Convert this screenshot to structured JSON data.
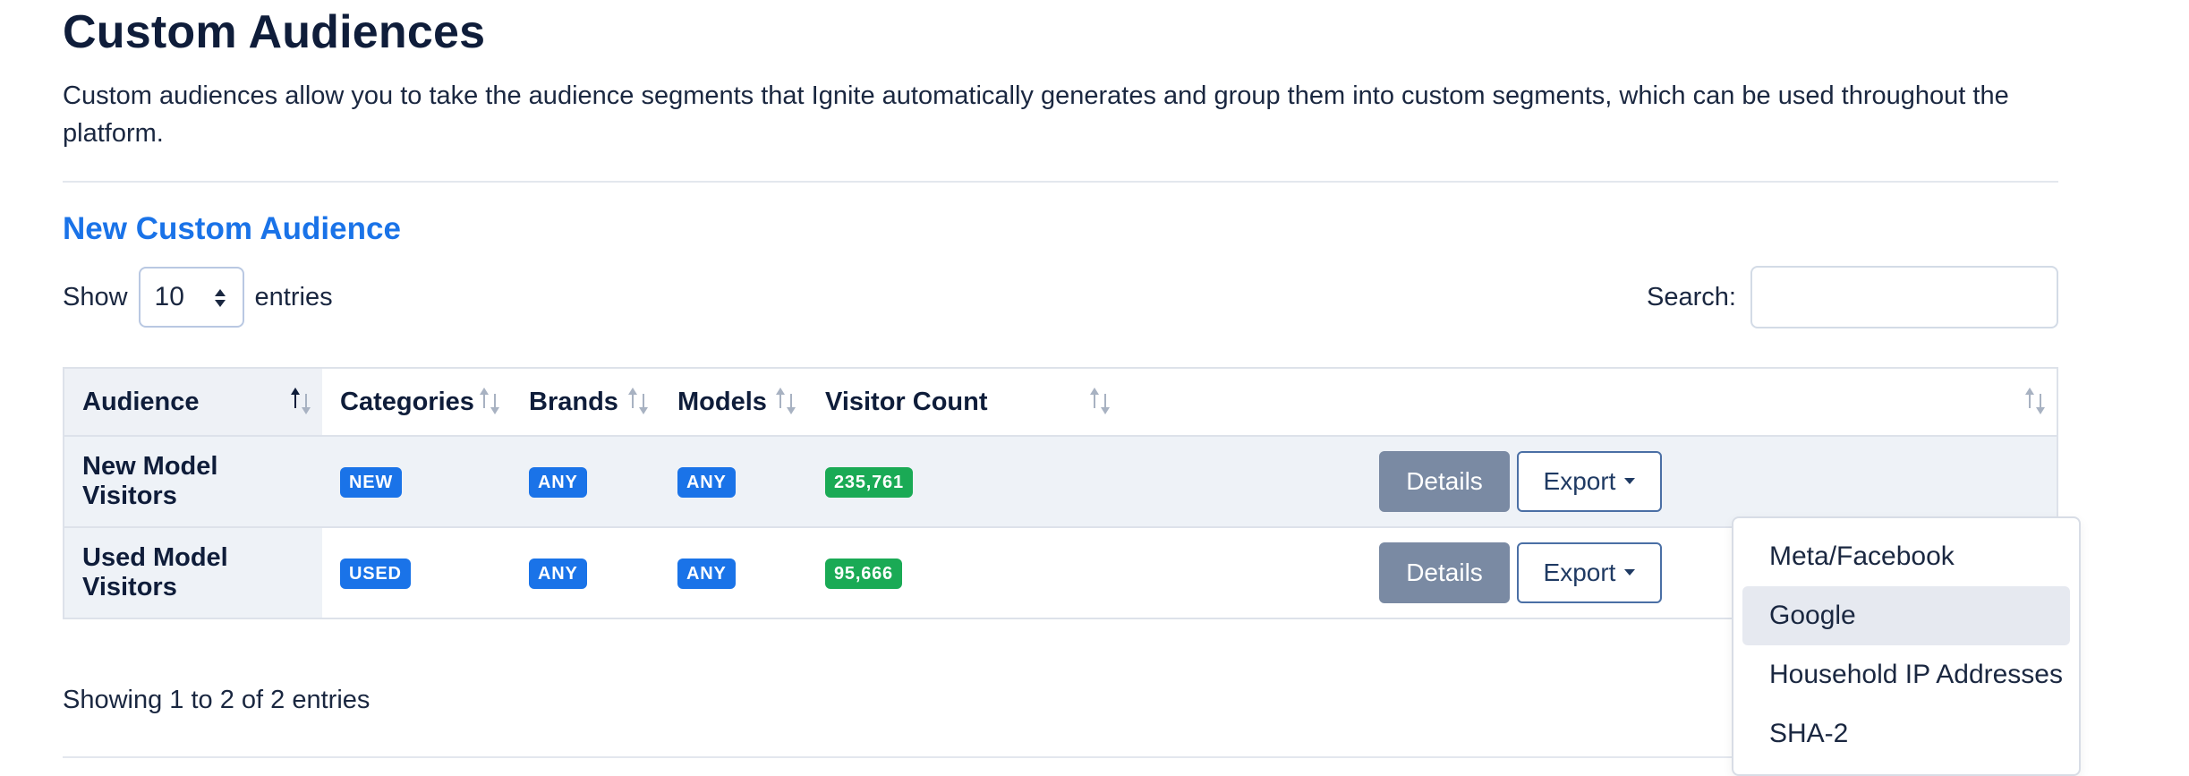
{
  "header": {
    "title": "Custom Audiences",
    "description": "Custom audiences allow you to take the audience segments that Ignite automatically generates and group them into custom segments, which can be used throughout the platform.",
    "new_link": "New Custom Audience"
  },
  "length": {
    "show_label": "Show",
    "value": "10",
    "entries_label": "entries"
  },
  "search": {
    "label": "Search:",
    "value": "",
    "placeholder": ""
  },
  "table": {
    "columns": [
      "Audience",
      "Categories",
      "Brands",
      "Models",
      "Visitor Count",
      ""
    ],
    "sorted_column": "Audience",
    "rows": [
      {
        "audience": "New Model Visitors",
        "category": "NEW",
        "brand": "ANY",
        "model": "ANY",
        "visitors": "235,761"
      },
      {
        "audience": "Used Model Visitors",
        "category": "USED",
        "brand": "ANY",
        "model": "ANY",
        "visitors": "95,666"
      }
    ],
    "details_label": "Details",
    "export_label": "Export"
  },
  "export_menu": {
    "items": [
      "Meta/Facebook",
      "Google",
      "Household IP Addresses",
      "SHA-2"
    ],
    "highlighted": "Google"
  },
  "footer": {
    "info": "Showing 1 to 2 of 2 entries"
  },
  "colors": {
    "primary_blue": "#1a73e8",
    "success_green": "#1aaa55",
    "details_gray": "#7a8aa3",
    "heading_navy": "#0f1d3a"
  }
}
